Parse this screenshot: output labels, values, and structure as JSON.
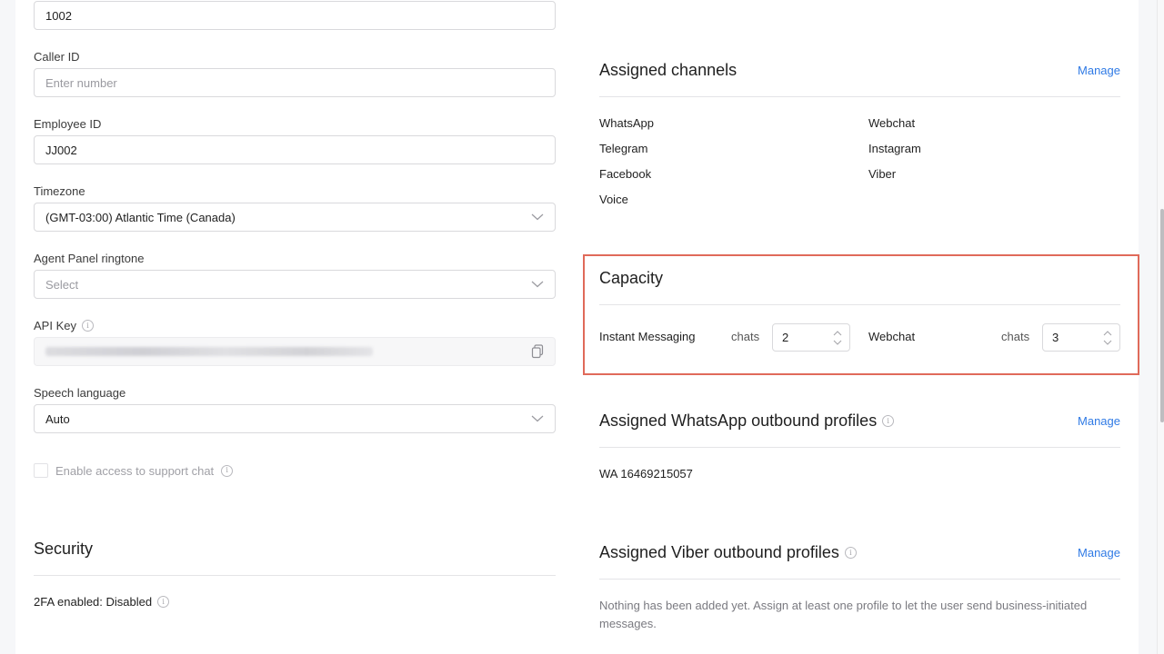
{
  "left": {
    "extension": {
      "value": "1002"
    },
    "caller_id": {
      "label": "Caller ID",
      "placeholder": "Enter number"
    },
    "employee_id": {
      "label": "Employee ID",
      "value": "JJ002"
    },
    "timezone": {
      "label": "Timezone",
      "value": "(GMT-03:00) Atlantic Time (Canada)"
    },
    "ringtone": {
      "label": "Agent Panel ringtone",
      "placeholder": "Select"
    },
    "api_key": {
      "label": "API Key",
      "value_hidden": true
    },
    "speech_language": {
      "label": "Speech language",
      "value": "Auto"
    },
    "support_chat": {
      "label": "Enable access to support chat",
      "checked": false
    },
    "security": {
      "title": "Security",
      "twofa": "2FA enabled: Disabled"
    }
  },
  "right": {
    "channels": {
      "title": "Assigned channels",
      "manage": "Manage",
      "col1": [
        "WhatsApp",
        "Telegram",
        "Facebook",
        "Voice"
      ],
      "col2": [
        "Webchat",
        "Instagram",
        "Viber"
      ]
    },
    "capacity": {
      "title": "Capacity",
      "items": [
        {
          "label": "Instant Messaging",
          "unit": "chats",
          "value": "2"
        },
        {
          "label": "Webchat",
          "unit": "chats",
          "value": "3"
        }
      ]
    },
    "whatsapp_profiles": {
      "title": "Assigned WhatsApp outbound profiles",
      "manage": "Manage",
      "items": [
        "WA 16469215057"
      ]
    },
    "viber_profiles": {
      "title": "Assigned Viber outbound profiles",
      "manage": "Manage",
      "empty": "Nothing has been added yet. Assign at least one profile to let the user send business-initiated messages."
    }
  },
  "colors": {
    "accent_link": "#2f7ae5",
    "highlight_border": "#e06a5a"
  }
}
